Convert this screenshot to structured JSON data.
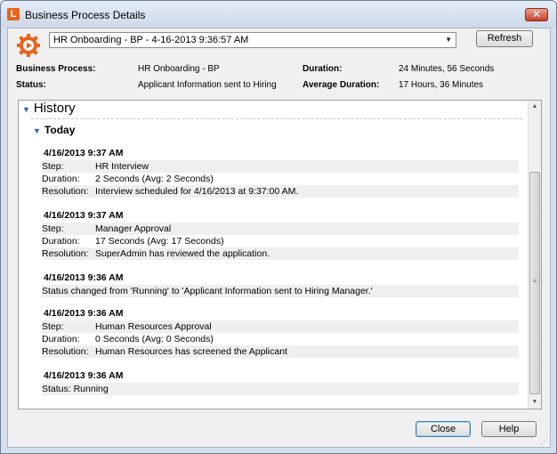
{
  "window": {
    "title": "Business Process Details",
    "close_symbol": "✕"
  },
  "toolbar": {
    "process_select": "HR Onboarding - BP - 4-16-2013 9:36:57 AM",
    "refresh_label": "Refresh"
  },
  "info": {
    "business_process_label": "Business Process:",
    "business_process_value": "HR Onboarding - BP",
    "status_label": "Status:",
    "status_value": "Applicant Information sent to Hiring",
    "duration_label": "Duration:",
    "duration_value": "24 Minutes, 56 Seconds",
    "avg_duration_label": "Average Duration:",
    "avg_duration_value": "17 Hours, 36 Minutes"
  },
  "history": {
    "title": "History",
    "group": "Today",
    "entries": [
      {
        "time": "4/16/2013 9:37 AM",
        "step_label": "Step:",
        "step": "HR Interview",
        "duration_label": "Duration:",
        "duration": "2 Seconds (Avg: 2 Seconds)",
        "resolution_label": "Resolution:",
        "resolution": "Interview scheduled for 4/16/2013 at 9:37:00 AM."
      },
      {
        "time": "4/16/2013 9:37 AM",
        "step_label": "Step:",
        "step": "Manager Approval",
        "duration_label": "Duration:",
        "duration": "17 Seconds (Avg: 17 Seconds)",
        "resolution_label": "Resolution:",
        "resolution": "SuperAdmin has reviewed the application."
      },
      {
        "time": "4/16/2013 9:36 AM",
        "message": "Status changed from 'Running' to 'Applicant Information sent to Hiring Manager.'"
      },
      {
        "time": "4/16/2013 9:36 AM",
        "step_label": "Step:",
        "step": "Human Resources Approval",
        "duration_label": "Duration:",
        "duration": "0 Seconds (Avg: 0 Seconds)",
        "resolution_label": "Resolution:",
        "resolution": "Human Resources has screened the Applicant"
      },
      {
        "time": "4/16/2013 9:36 AM",
        "message": "Status: Running"
      }
    ]
  },
  "footer": {
    "close_label": "Close",
    "help_label": "Help"
  }
}
